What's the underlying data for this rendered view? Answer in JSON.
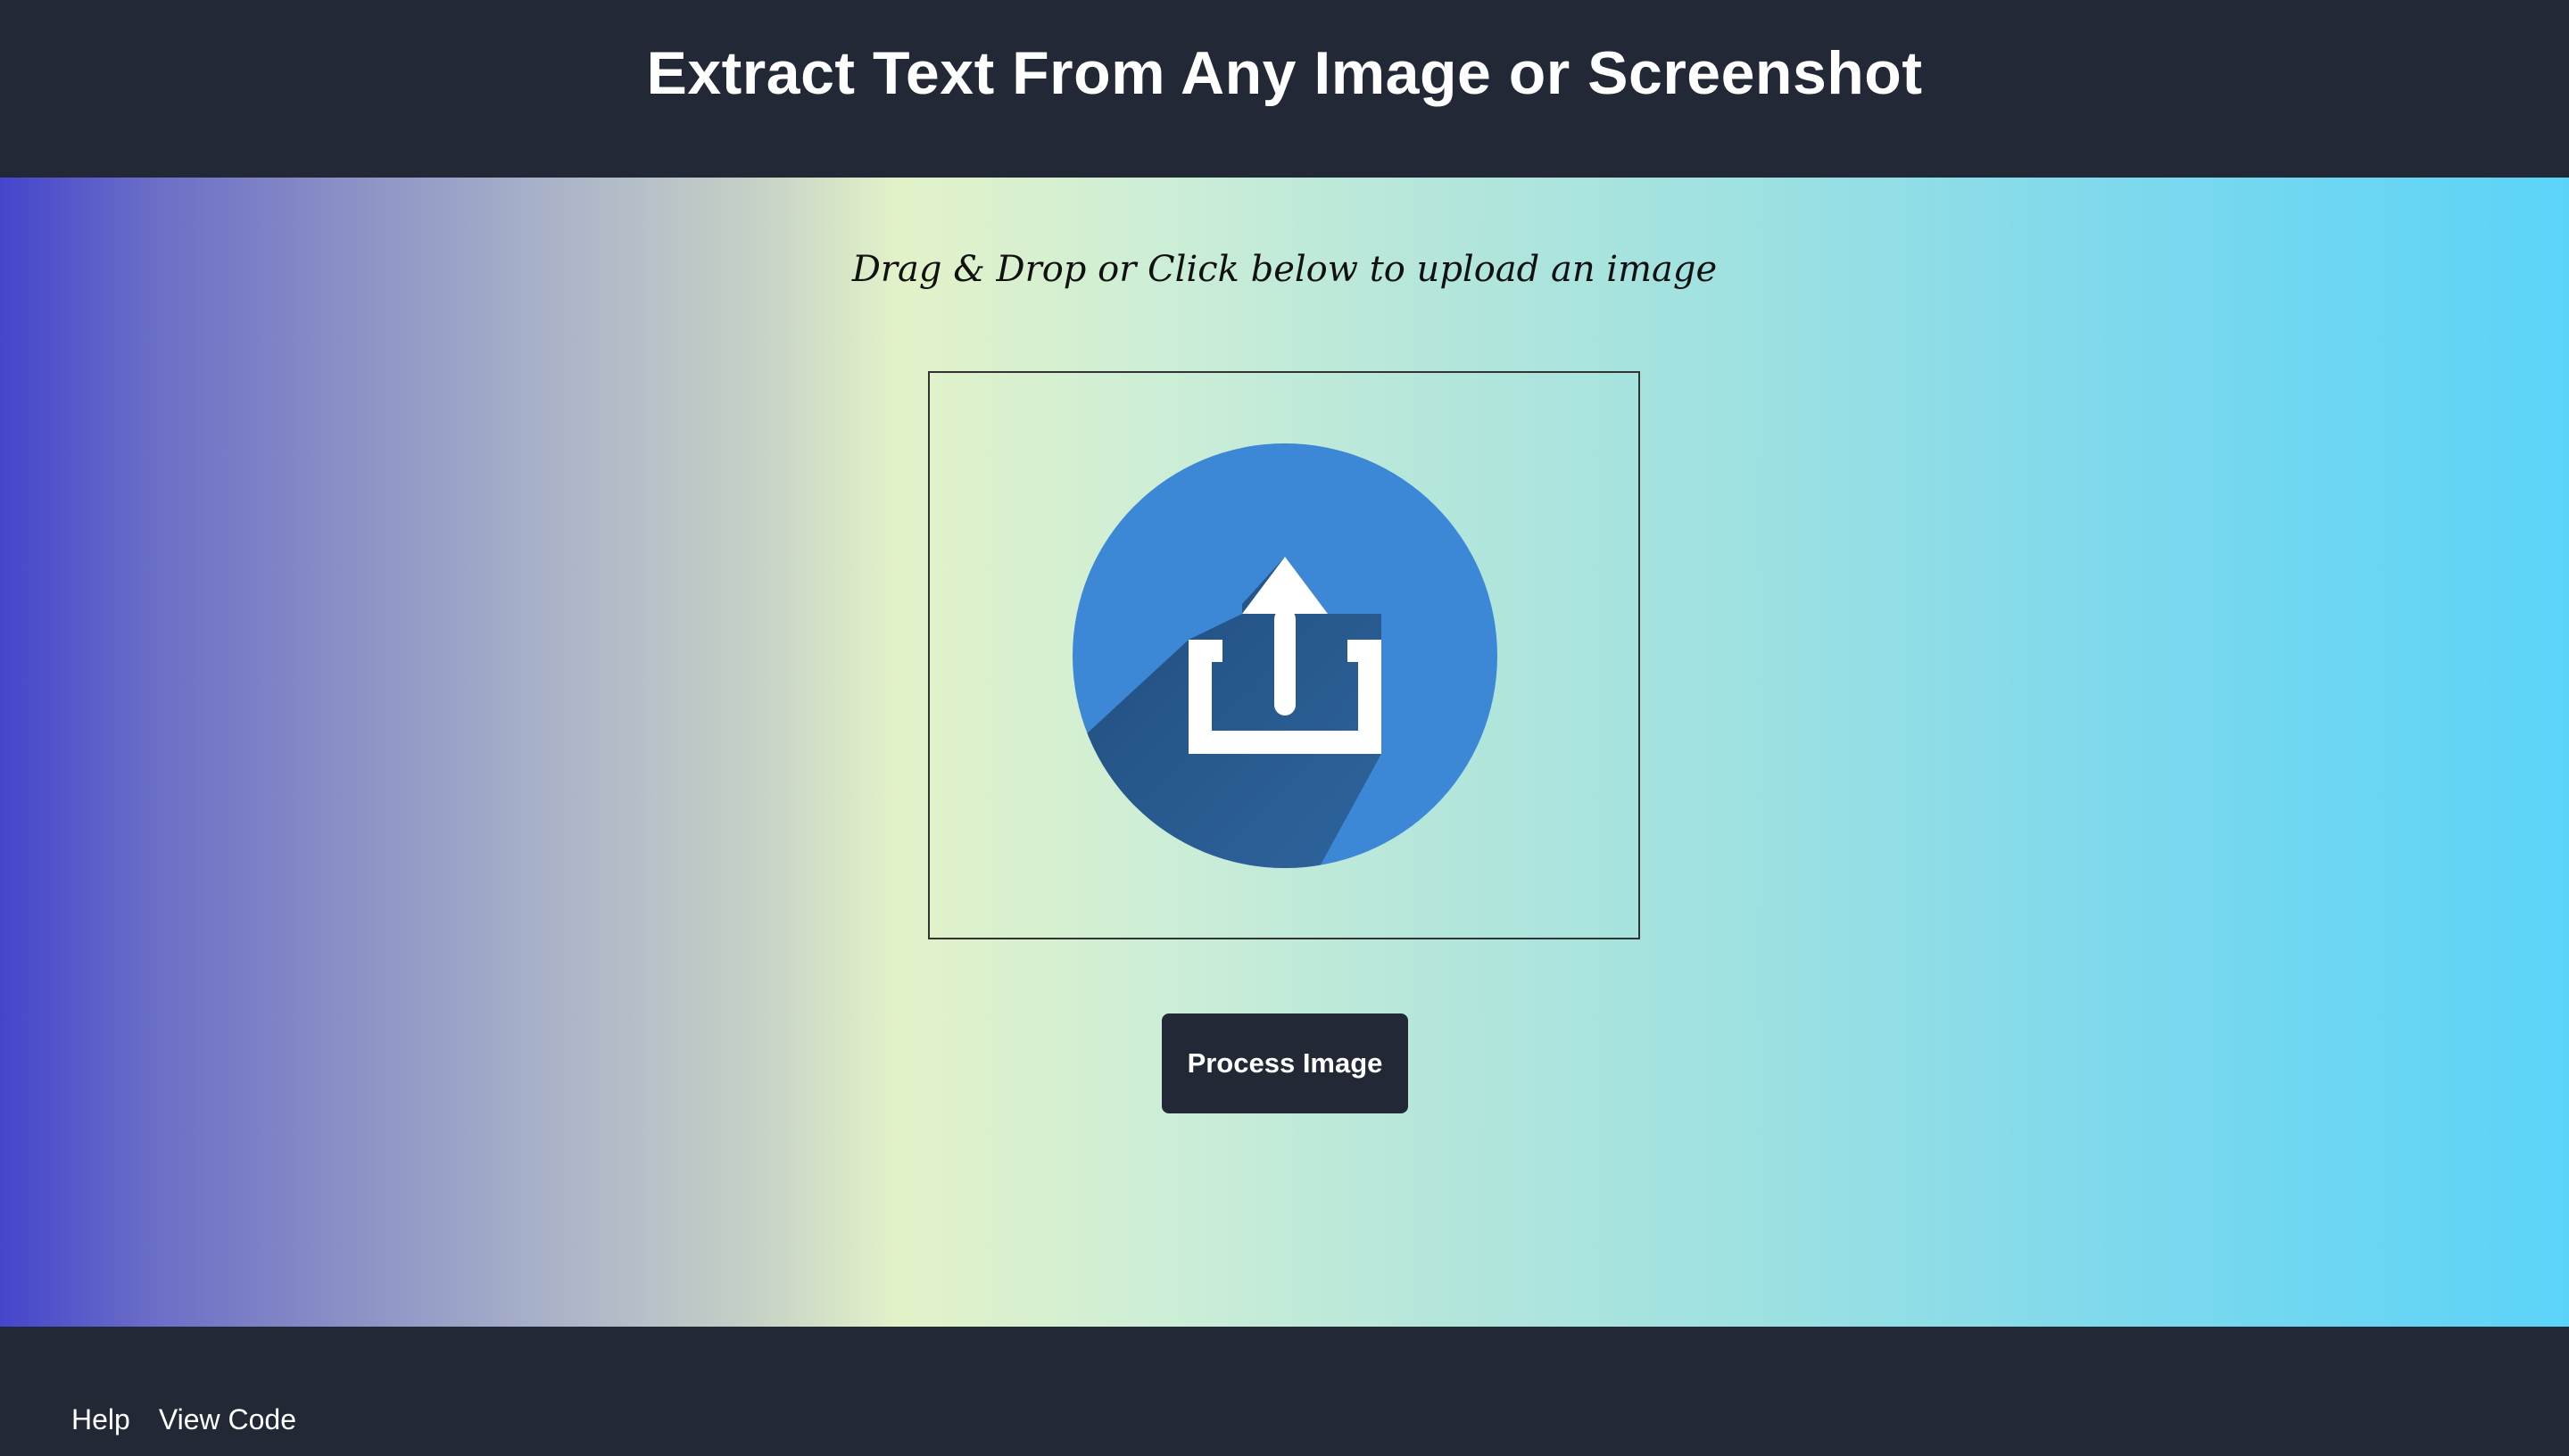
{
  "header": {
    "title": "Extract Text From Any Image or Screenshot"
  },
  "main": {
    "instructions": "Drag & Drop or Click below to upload an image",
    "dropzone": {
      "icon": "upload-icon"
    },
    "process_button_label": "Process Image"
  },
  "footer": {
    "links": [
      {
        "label": "Help"
      },
      {
        "label": "View Code"
      }
    ]
  },
  "colors": {
    "header_footer_bg": "#222836",
    "upload_circle": "#3d88d6",
    "upload_shadow": "#23507f",
    "gradient_left": "#4545cc",
    "gradient_mid": "#e2f2c8",
    "gradient_right": "#5bd3f8"
  }
}
